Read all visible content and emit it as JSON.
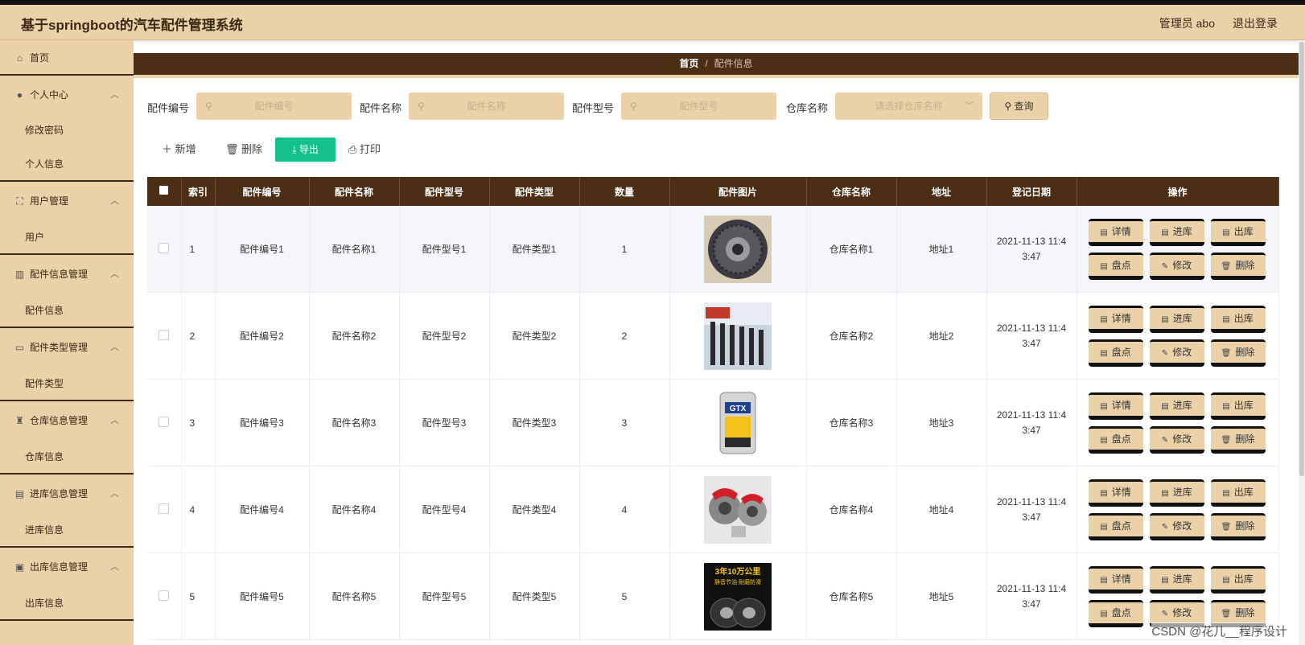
{
  "header": {
    "title": "基于springboot的汽车配件管理系统",
    "user": "管理员 abo",
    "logout": "退出登录"
  },
  "sidebar": {
    "home": "首页",
    "groups": [
      {
        "label": "个人中心",
        "icon": "user-icon",
        "children": [
          "修改密码",
          "个人信息"
        ]
      },
      {
        "label": "用户管理",
        "icon": "frame-icon",
        "children": [
          "用户"
        ]
      },
      {
        "label": "配件信息管理",
        "icon": "library-icon",
        "children": [
          "配件信息"
        ]
      },
      {
        "label": "配件类型管理",
        "icon": "monitor-icon",
        "children": [
          "配件类型"
        ]
      },
      {
        "label": "仓库信息管理",
        "icon": "trophy-icon",
        "children": [
          "仓库信息"
        ]
      },
      {
        "label": "进库信息管理",
        "icon": "clipboard-icon",
        "children": [
          "进库信息"
        ]
      },
      {
        "label": "出库信息管理",
        "icon": "briefcase-icon",
        "children": [
          "出库信息"
        ]
      }
    ]
  },
  "breadcrumb": {
    "home": "首页",
    "sep": "/",
    "current": "配件信息"
  },
  "search": {
    "code_label": "配件编号",
    "code_placeholder": "配件编号",
    "name_label": "配件名称",
    "name_placeholder": "配件名称",
    "model_label": "配件型号",
    "model_placeholder": "配件型号",
    "warehouse_label": "仓库名称",
    "warehouse_placeholder": "请选择仓库名称",
    "query_button": "查询"
  },
  "toolbar": {
    "add": "新增",
    "delete": "删除",
    "export": "导出",
    "print": "打印"
  },
  "table": {
    "columns": [
      "索引",
      "配件编号",
      "配件名称",
      "配件型号",
      "配件类型",
      "数量",
      "配件图片",
      "仓库名称",
      "地址",
      "登记日期",
      "操作"
    ],
    "rows": [
      {
        "index": "1",
        "code": "配件编号1",
        "name": "配件名称1",
        "model": "配件型号1",
        "type": "配件类型1",
        "qty": "1",
        "image": "clutch-disc-photo",
        "warehouse": "仓库名称1",
        "address": "地址1",
        "date": "2021-11-13 11:43:47"
      },
      {
        "index": "2",
        "code": "配件编号2",
        "name": "配件名称2",
        "model": "配件型号2",
        "type": "配件类型2",
        "qty": "2",
        "image": "spark-plugs-photo",
        "warehouse": "仓库名称2",
        "address": "地址2",
        "date": "2021-11-13 11:43:47"
      },
      {
        "index": "3",
        "code": "配件编号3",
        "name": "配件名称3",
        "model": "配件型号3",
        "type": "配件类型3",
        "qty": "3",
        "image": "engine-oil-photo",
        "warehouse": "仓库名称3",
        "address": "地址3",
        "date": "2021-11-13 11:43:47"
      },
      {
        "index": "4",
        "code": "配件编号4",
        "name": "配件名称4",
        "model": "配件型号4",
        "type": "配件类型4",
        "qty": "4",
        "image": "brake-calipers-photo",
        "warehouse": "仓库名称4",
        "address": "地址4",
        "date": "2021-11-13 11:43:47"
      },
      {
        "index": "5",
        "code": "配件编号5",
        "name": "配件名称5",
        "model": "配件型号5",
        "type": "配件类型5",
        "qty": "5",
        "image": "tires-ad-photo",
        "warehouse": "仓库名称5",
        "address": "地址5",
        "date": "2021-11-13 11:43:47"
      }
    ],
    "actions": [
      "详情",
      "进库",
      "出库",
      "盘点",
      "修改",
      "删除"
    ],
    "image_texts": {
      "oil_brand": "GTX",
      "tire_ad_line1": "3年10万公里",
      "tire_ad_line2": "静音节油 耐磨防滑"
    }
  },
  "watermark": {
    "text": "CSDN @花儿__程序设计"
  },
  "colors": {
    "header_bg": "#ead1a8",
    "table_header_bg": "#4c2e14",
    "export_green": "#14c08c"
  }
}
